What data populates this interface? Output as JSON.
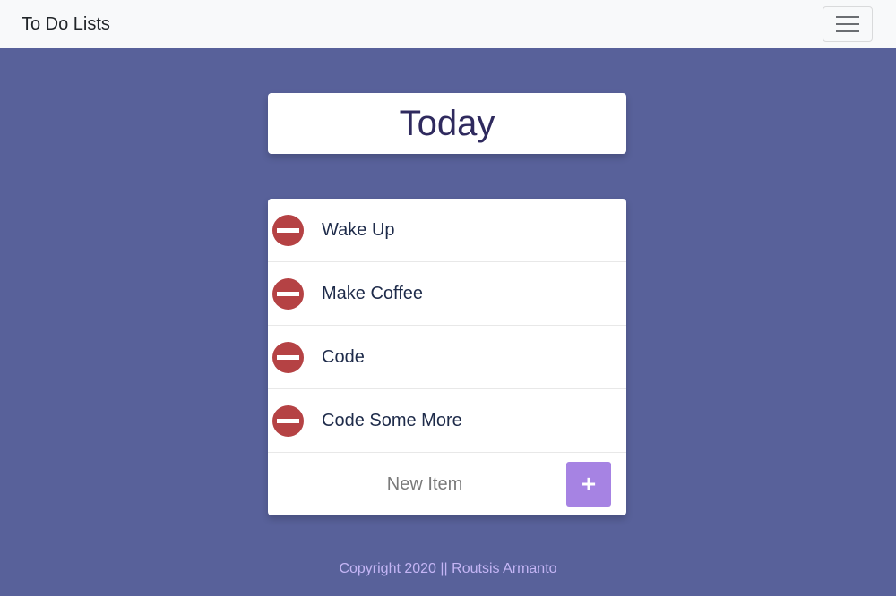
{
  "navbar": {
    "brand": "To Do Lists",
    "menu_icon": "hamburger-menu-icon"
  },
  "list": {
    "title": "Today",
    "items": [
      {
        "label": "Wake Up",
        "icon": "remove-circle-icon"
      },
      {
        "label": "Make Coffee",
        "icon": "remove-circle-icon"
      },
      {
        "label": "Code",
        "icon": "remove-circle-icon"
      },
      {
        "label": "Code Some More",
        "icon": "remove-circle-icon"
      }
    ],
    "new_item_placeholder": "New Item",
    "add_button_label": "+"
  },
  "footer": {
    "text": "Copyright 2020 || Routsis Armanto"
  },
  "colors": {
    "background": "#58619a",
    "remove_button": "#b54244",
    "add_button": "#a683e3",
    "footer_text": "#c4b5f5"
  }
}
